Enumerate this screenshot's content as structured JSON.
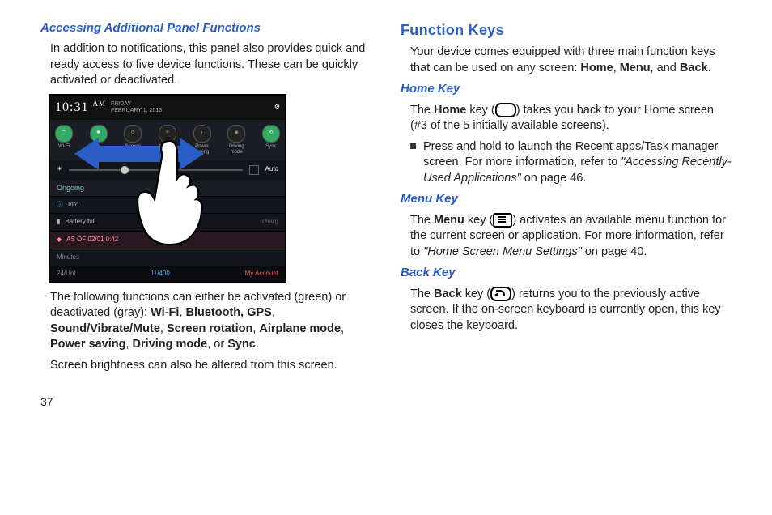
{
  "left": {
    "heading": "Accessing Additional Panel Functions",
    "intro": "In addition to notifications, this panel also provides quick and ready access to five device functions. These can be quickly activated or deactivated.",
    "func_intro": "The following functions can either be activated (green) or deactivated (gray): ",
    "funcs": {
      "wifi": "Wi-Fi",
      "bt_gps": "Bluetooth, GPS",
      "sound": "Sound/Vibrate/Mute",
      "rotation": "Screen rotation",
      "airplane": "Airplane mode",
      "power": "Power saving",
      "driving": "Driving mode",
      "sync": "Sync"
    },
    "brightness_line": "Screen brightness can also be altered from this screen.",
    "phone": {
      "time": "10:31",
      "ampm": "AM",
      "day": "FRIDAY",
      "date": "FEBRUARY 1, 2013",
      "toggles": [
        "Wi-Fi",
        "Blu...",
        "Screen rotation",
        "Airplane mode",
        "Power saving",
        "Driving mode",
        "Sync"
      ],
      "auto": "Auto",
      "ongoing": "Ongoing",
      "info": "Info",
      "batt": "Battery full",
      "asof": "AS OF 02/01 0:42",
      "min": "Minutes",
      "left_f": "24/Unl",
      "mid_f": "11/400",
      "right_f": "My Account"
    }
  },
  "right": {
    "heading": "Function Keys",
    "intro_a": "Your device comes equipped with three main function keys that can be used on any screen: ",
    "home_b": "Home",
    "menu_b": "Menu",
    "back_b": "Back",
    "home": {
      "title": "Home Key",
      "p1a": "The ",
      "p1b": "Home",
      "p1c": " key (",
      "p1d": ") takes you back to your Home screen (#3 of the 5 initially available screens).",
      "bullet_a": "Press and hold to launch the Recent apps/Task manager screen. For more information, refer to ",
      "bullet_b": "\"Accessing Recently-Used Applications\"",
      "bullet_c": " on page 46."
    },
    "menu": {
      "title": "Menu Key",
      "p1a": "The ",
      "p1b": "Menu",
      "p1c": " key (",
      "p1d": ") activates an available menu function for the current screen or application. For more information, refer to ",
      "p1e": "\"Home Screen Menu Settings\"",
      "p1f": " on page 40."
    },
    "back": {
      "title": "Back Key",
      "p1a": "The ",
      "p1b": "Back",
      "p1c": " key (",
      "p1d": ") returns you to the previously active screen. If the on-screen keyboard is currently open, this key closes the keyboard."
    }
  },
  "page": "37"
}
